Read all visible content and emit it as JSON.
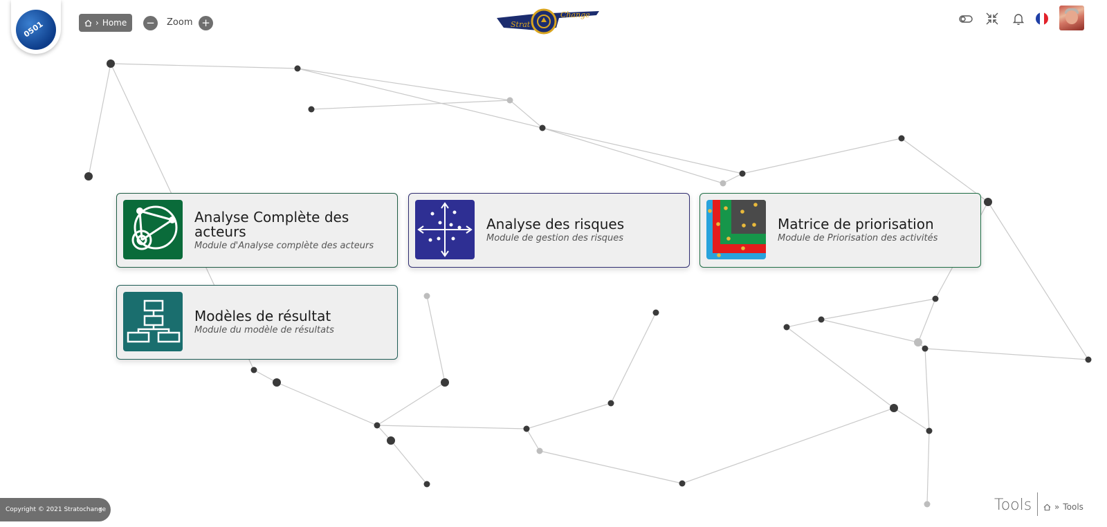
{
  "header": {
    "logo_text": "0501",
    "home_label": "Home",
    "zoom_label": "Zoom",
    "zoom_minus": "−",
    "zoom_plus": "+",
    "brand_left": "Strat",
    "brand_right": "Change",
    "icons": [
      "toggle-icon",
      "compress-icon",
      "bell-icon",
      "flag-fr-icon",
      "avatar"
    ]
  },
  "modules": [
    {
      "title": "Analyse Complète des acteurs",
      "subtitle": "Module d'Analyse complète des acteurs",
      "color": "#0a6b3a",
      "border": "#1f5c44"
    },
    {
      "title": "Analyse des risques",
      "subtitle": "Module de gestion des risques",
      "color": "#2e2f93",
      "border": "#2f2d70"
    },
    {
      "title": "Matrice de priorisation",
      "subtitle": "Module de Priorisation des activités",
      "color": "#1fa04a",
      "border": "#1f6e45"
    },
    {
      "title": "Modèles de résultat",
      "subtitle": "Module du modèle de résultats",
      "color": "#1a6e6e",
      "border": "#1f5c55"
    }
  ],
  "footer": {
    "copyright": "Copyright © 2021 Stratochange",
    "collapse_glyph": "‹",
    "page_title": "Tools",
    "breadcrumb_sep": "»",
    "breadcrumb_current": "Tools"
  }
}
